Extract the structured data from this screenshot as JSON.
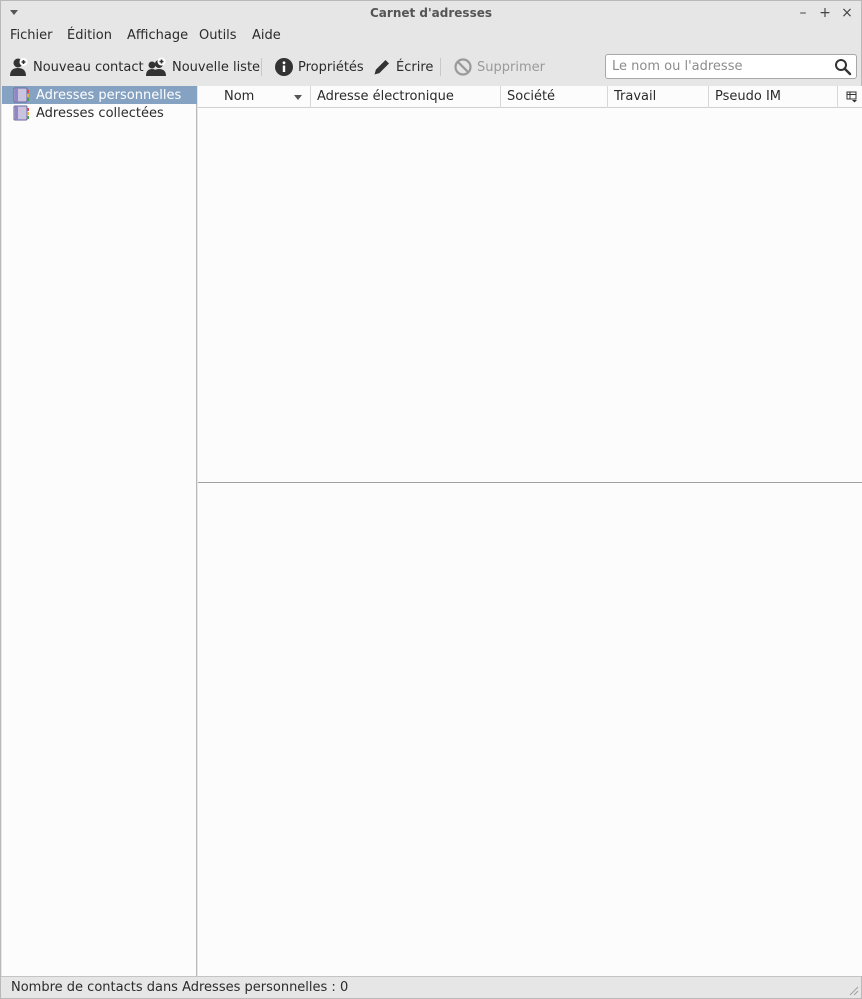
{
  "window": {
    "title": "Carnet d'adresses"
  },
  "menubar": {
    "items": [
      {
        "label": "Fichier"
      },
      {
        "label": "Édition"
      },
      {
        "label": "Affichage"
      },
      {
        "label": "Outils"
      },
      {
        "label": "Aide"
      }
    ]
  },
  "toolbar": {
    "new_contact": "Nouveau contact",
    "new_list": "Nouvelle liste",
    "properties": "Propriétés",
    "write": "Écrire",
    "delete": "Supprimer",
    "search_placeholder": "Le nom ou l'adresse"
  },
  "sidebar": {
    "items": [
      {
        "label": "Adresses personnelles",
        "selected": true
      },
      {
        "label": "Adresses collectées",
        "selected": false
      }
    ]
  },
  "list": {
    "columns": [
      "Nom",
      "Adresse électronique",
      "Société",
      "Travail",
      "Pseudo IM"
    ],
    "rows": []
  },
  "status": {
    "text": "Nombre de contacts dans Adresses personnelles : 0"
  },
  "colors": {
    "selection": "#86a2c2",
    "accent_icon": "#333333"
  }
}
